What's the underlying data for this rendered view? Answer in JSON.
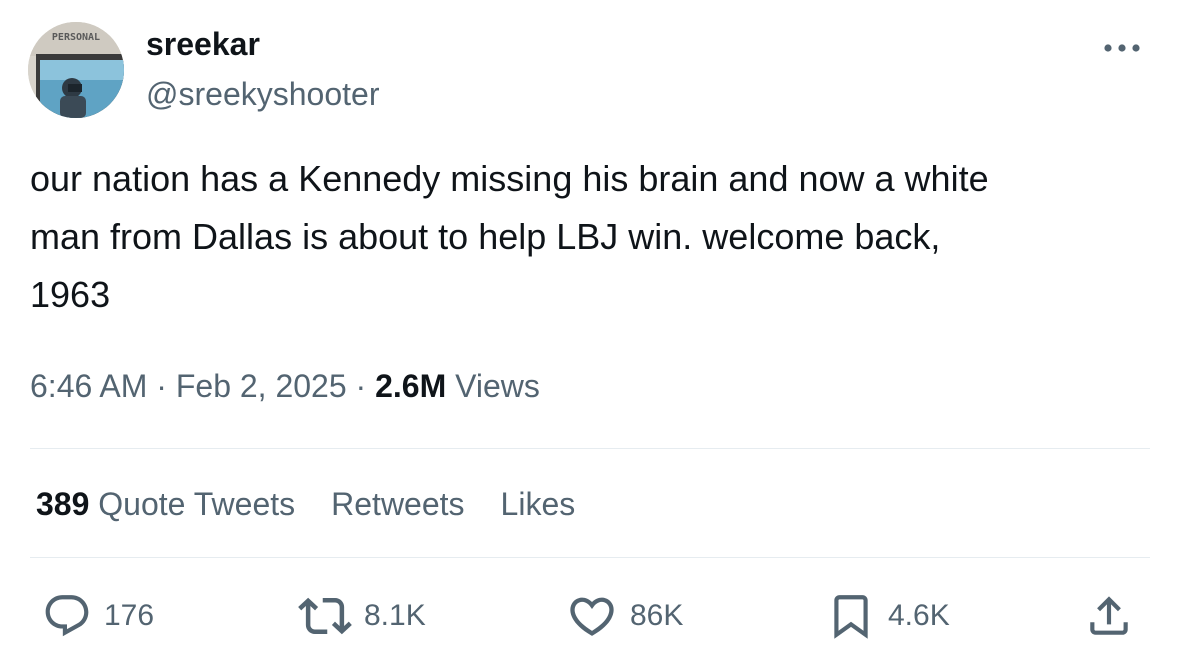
{
  "author": {
    "display_name": "sreekar",
    "handle": "@sreekyshooter",
    "avatar_badge_text": "PERSONAL"
  },
  "tweet": {
    "text": "our nation has a Kennedy missing his brain and now a white\nman from Dallas is about to help LBJ win. welcome back,\n1963",
    "time": "6:46 AM",
    "date": "Feb 2, 2025",
    "separator": "·",
    "views_count": "2.6M",
    "views_label": "Views"
  },
  "stats": {
    "quote_count": "389",
    "quote_label": "Quote Tweets",
    "retweets_label": "Retweets",
    "likes_label": "Likes"
  },
  "actions": {
    "replies": "176",
    "retweets": "8.1K",
    "likes": "86K",
    "bookmarks": "4.6K"
  },
  "icons": {
    "more": "more-horizontal-icon",
    "reply": "reply-icon",
    "retweet": "retweet-icon",
    "like": "heart-icon",
    "bookmark": "bookmark-icon",
    "share": "share-icon"
  },
  "colors": {
    "text_primary": "#0f1419",
    "text_secondary": "#536471",
    "divider": "#e6ecf0"
  }
}
